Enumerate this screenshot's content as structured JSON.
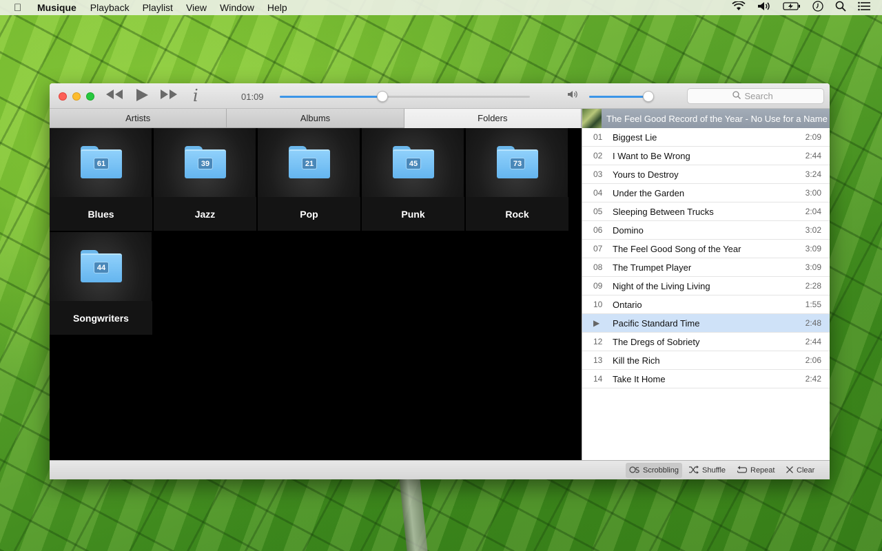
{
  "menubar": {
    "apple_icon": "apple-icon",
    "app_name": "Musique",
    "items": [
      "Playback",
      "Playlist",
      "View",
      "Window",
      "Help"
    ],
    "status_icons": [
      "wifi-icon",
      "volume-icon",
      "battery-charging-icon",
      "clock-icon",
      "search-icon",
      "list-icon"
    ]
  },
  "player": {
    "elapsed": "01:09",
    "progress_fraction": 0.41,
    "volume_fraction": 0.95,
    "search_placeholder": "Search",
    "controls": [
      "previous-icon",
      "play-icon",
      "next-icon",
      "info-icon"
    ]
  },
  "tabs": [
    {
      "label": "Artists",
      "active": false
    },
    {
      "label": "Albums",
      "active": false
    },
    {
      "label": "Folders",
      "active": true
    }
  ],
  "folders": [
    {
      "name": "Blues",
      "count": "61"
    },
    {
      "name": "Jazz",
      "count": "39"
    },
    {
      "name": "Pop",
      "count": "21"
    },
    {
      "name": "Punk",
      "count": "45"
    },
    {
      "name": "Rock",
      "count": "73"
    },
    {
      "name": "Songwriters",
      "count": "44"
    }
  ],
  "playlist": {
    "header": "The Feel Good Record of the Year - No Use for a Name",
    "tracks": [
      {
        "num": "01",
        "title": "Biggest Lie",
        "duration": "2:09"
      },
      {
        "num": "02",
        "title": "I Want to Be Wrong",
        "duration": "2:44"
      },
      {
        "num": "03",
        "title": "Yours to Destroy",
        "duration": "3:24"
      },
      {
        "num": "04",
        "title": "Under the Garden",
        "duration": "3:00"
      },
      {
        "num": "05",
        "title": "Sleeping Between Trucks",
        "duration": "2:04"
      },
      {
        "num": "06",
        "title": "Domino",
        "duration": "3:02"
      },
      {
        "num": "07",
        "title": "The Feel Good Song of the Year",
        "duration": "3:09"
      },
      {
        "num": "08",
        "title": "The Trumpet Player",
        "duration": "3:09"
      },
      {
        "num": "09",
        "title": "Night of the Living Living",
        "duration": "2:28"
      },
      {
        "num": "10",
        "title": "Ontario",
        "duration": "1:55"
      },
      {
        "num": "▶",
        "title": "Pacific Standard Time",
        "duration": "2:48",
        "playing": true
      },
      {
        "num": "12",
        "title": "The Dregs of Sobriety",
        "duration": "2:44"
      },
      {
        "num": "13",
        "title": "Kill the Rich",
        "duration": "2:06"
      },
      {
        "num": "14",
        "title": "Take It Home",
        "duration": "2:42"
      }
    ]
  },
  "statusbar": {
    "scrobbling": "Scrobbling",
    "shuffle": "Shuffle",
    "repeat": "Repeat",
    "clear": "Clear"
  }
}
